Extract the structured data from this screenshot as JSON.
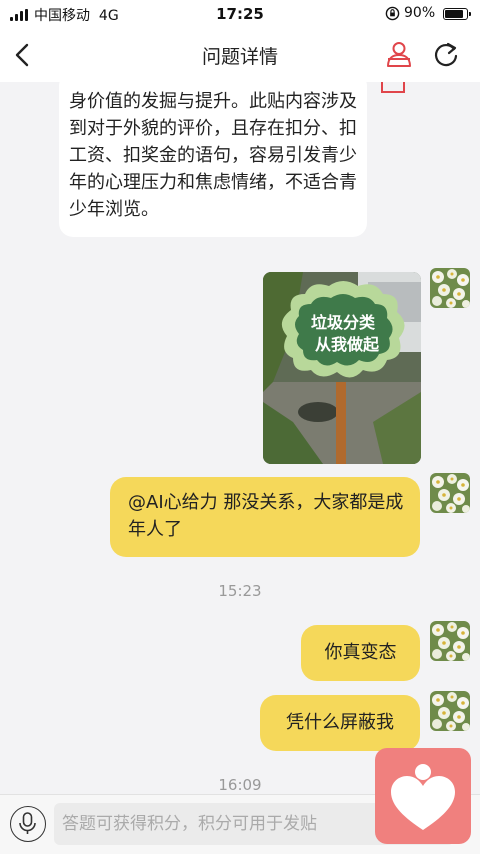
{
  "status_bar": {
    "carrier": "中国移动",
    "network": "4G",
    "time": "17:25",
    "battery": "90%"
  },
  "nav": {
    "title": "问题详情",
    "back_icon": "chevron-left-icon",
    "user_icon": "user-icon",
    "refresh_icon": "refresh-icon",
    "accent_color": "#e0454a"
  },
  "messages": {
    "left_text": "身价值的发掘与提升。此贴内容涉及到对于外貌的评价，且存在扣分、扣工资、扣奖金的语句，容易引发青少年的心理压力和焦虑情绪，不适合青少年浏览。",
    "photo_sign_line1": "垃圾分类",
    "photo_sign_line2": "从我做起",
    "right_1": "@AI心给力 那没关系，大家都是成年人了",
    "timestamp_1": "15:23",
    "right_2": "你真变态",
    "right_3": "凭什么屏蔽我",
    "timestamp_2": "16:09",
    "bubble_color": "#f5d85a"
  },
  "input_bar": {
    "placeholder": "答题可获得积分，积分可用于发贴",
    "mic_icon": "microphone-icon"
  },
  "fab": {
    "icon": "heart-person-icon",
    "color": "#f0807e"
  }
}
